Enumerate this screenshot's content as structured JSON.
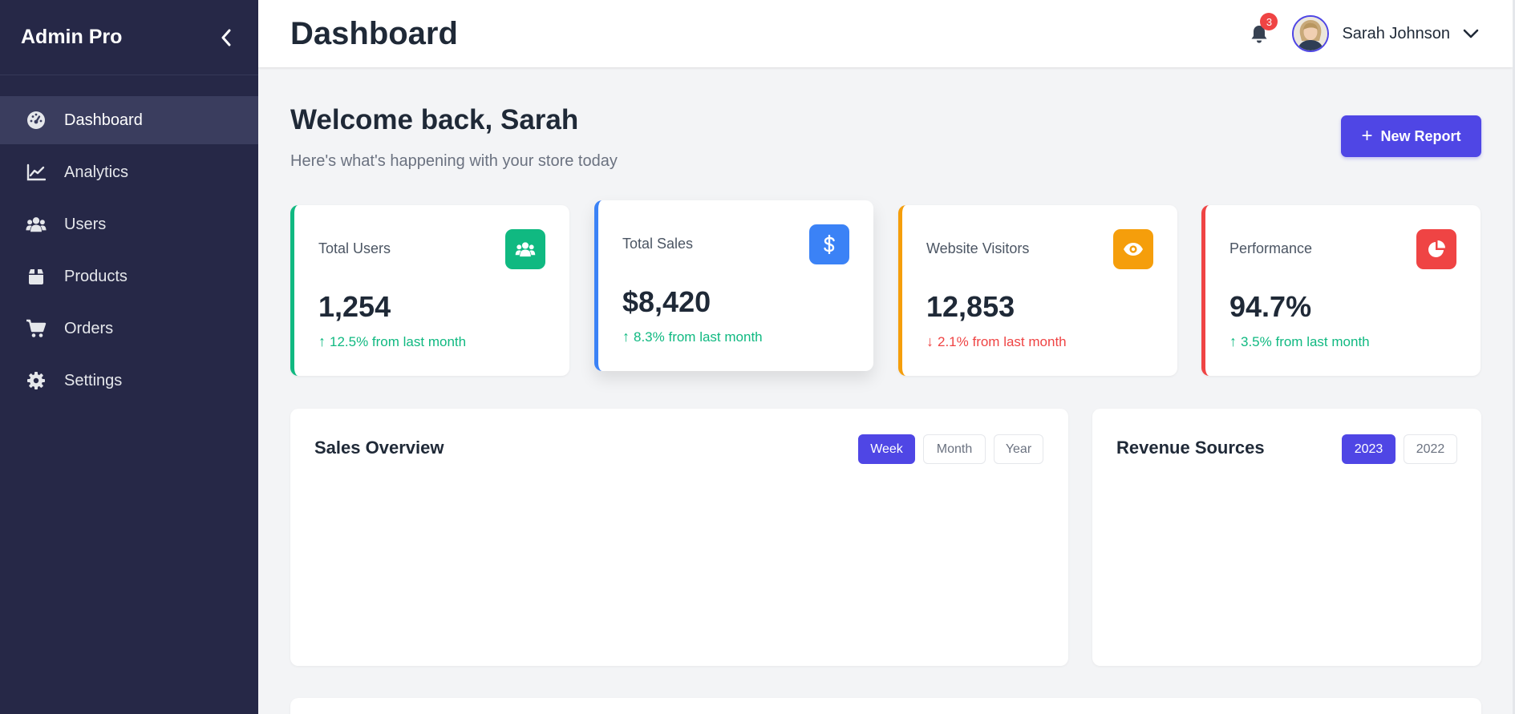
{
  "sidebar": {
    "brand": "Admin Pro",
    "items": [
      {
        "label": "Dashboard",
        "icon": "dashboard-icon",
        "active": true
      },
      {
        "label": "Analytics",
        "icon": "line-chart-icon"
      },
      {
        "label": "Users",
        "icon": "users-icon"
      },
      {
        "label": "Products",
        "icon": "box-icon"
      },
      {
        "label": "Orders",
        "icon": "cart-icon"
      },
      {
        "label": "Settings",
        "icon": "gear-icon"
      }
    ]
  },
  "header": {
    "title": "Dashboard",
    "notification_count": "3",
    "user_name": "Sarah Johnson"
  },
  "welcome": {
    "title": "Welcome back, Sarah",
    "subtitle": "Here's what's happening with your store today",
    "new_report_label": "New Report"
  },
  "stats": [
    {
      "label": "Total Users",
      "value": "1,254",
      "change": "12.5% from last month",
      "trend": "up",
      "color": "#10b981",
      "icon": "users-icon"
    },
    {
      "label": "Total Sales",
      "value": "$8,420",
      "change": "8.3% from last month",
      "trend": "up",
      "color": "#3b82f6",
      "icon": "dollar-icon"
    },
    {
      "label": "Website Visitors",
      "value": "12,853",
      "change": "2.1% from last month",
      "trend": "down",
      "color": "#f59e0b",
      "icon": "eye-icon"
    },
    {
      "label": "Performance",
      "value": "94.7%",
      "change": "3.5% from last month",
      "trend": "up",
      "color": "#ef4444",
      "icon": "pie-chart-icon"
    }
  ],
  "sales_overview": {
    "title": "Sales Overview",
    "tabs": [
      {
        "label": "Week",
        "active": true
      },
      {
        "label": "Month",
        "active": false
      },
      {
        "label": "Year",
        "active": false
      }
    ]
  },
  "revenue_sources": {
    "title": "Revenue Sources",
    "tabs": [
      {
        "label": "2023",
        "active": true
      },
      {
        "label": "2022",
        "active": false
      }
    ]
  },
  "colors": {
    "sidebar_bg": "#262847",
    "accent": "#4f46e5",
    "page_bg": "#f3f4f6",
    "positive": "#10b981",
    "negative": "#ef4444"
  }
}
